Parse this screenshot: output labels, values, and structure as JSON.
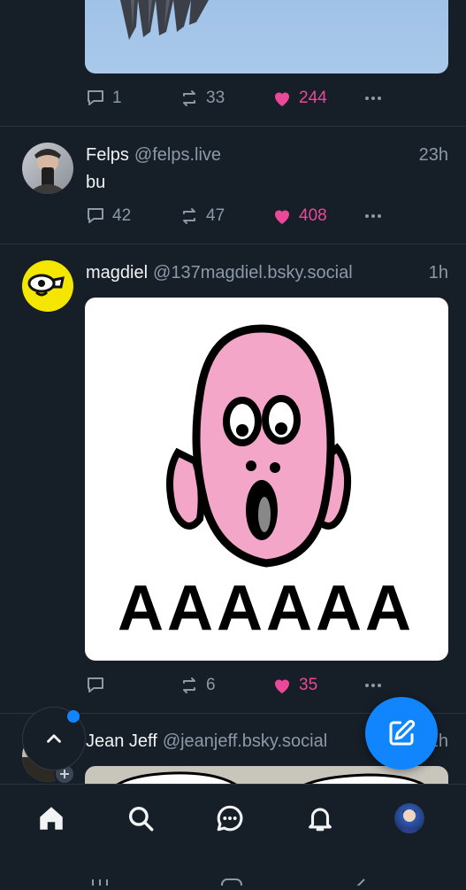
{
  "posts": [
    {
      "counts": {
        "replies": "1",
        "reposts": "33",
        "likes": "244"
      }
    },
    {
      "author": "Felps",
      "handle": "@felps.live",
      "time": "23h",
      "text": "bu",
      "counts": {
        "replies": "42",
        "reposts": "47",
        "likes": "408"
      }
    },
    {
      "author": "magdiel",
      "handle": "@137magdiel.bsky.social",
      "time": "1h",
      "image_text": "AAAAAA",
      "counts": {
        "replies": "",
        "reposts": "6",
        "likes": "35"
      }
    },
    {
      "author": "Jean Jeff",
      "handle": "@jeanjeff.bsky.social",
      "time": "1h"
    }
  ],
  "colors": {
    "background": "#161e27",
    "accent": "#1185fe",
    "like": "#ec4899",
    "muted": "#8c99a8"
  },
  "nav": {
    "items": [
      "home-icon",
      "search-icon",
      "chat-icon",
      "bell-icon",
      "profile-avatar"
    ]
  },
  "fab": {
    "icon": "compose-icon"
  },
  "scroll_button": {
    "icon": "chevron-up-icon"
  }
}
